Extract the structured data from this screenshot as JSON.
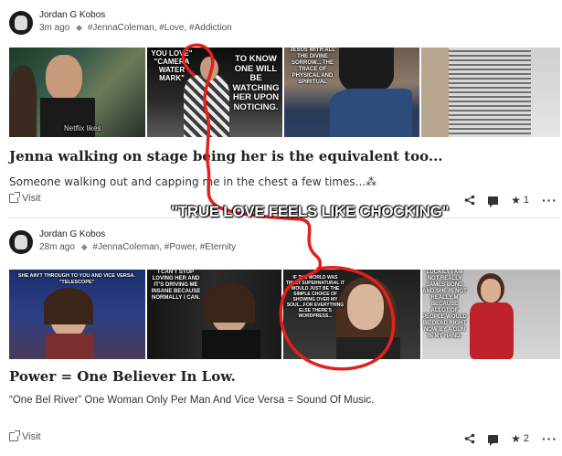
{
  "overlay_caption": "\"TRUE LOVE FEELS LIKE CHOCKING\"",
  "accent_color": "#e3201b",
  "posts": [
    {
      "author": "Jordan G Kobos",
      "time": "3m ago",
      "tags": "#JennaColeman, #Love, #Addiction",
      "images": [
        {
          "caption": "Netflix likes"
        },
        {
          "caption": "YOU LOVE\" \"CAMERA WATER MARK\""
        },
        {
          "caption": "TO KNOW ONE WILL BE WATCHING HER UPON NOTICING."
        },
        {
          "caption": "JESUS WITH ALL THE DIVINE SORROW... THE TRACE OF PHYSICAL AND SPIRITUAL"
        },
        {
          "caption": ""
        }
      ],
      "title": "Jenna walking on stage being her is the equivalent too...",
      "excerpt": "Someone walking out and capping me in the chest a few times...⁂",
      "visit_label": "Visit",
      "upvotes": "1"
    },
    {
      "author": "Jordan G Kobos",
      "time": "28m ago",
      "tags": "#JennaColeman, #Power, #Eternity",
      "images": [
        {
          "caption": "SHE AIN'T THROUGH TO YOU AND VICE VERSA. \"TELESCOPE\""
        },
        {
          "caption": "I CAN'T STOP LOVING HER AND IT'S DRIVING ME INSANE BECAUSE NORMALLY I CAN."
        },
        {
          "caption": ""
        },
        {
          "caption": "IF THE WORLD WAS TRULY SUPERNATURAL IT WOULD JUST BE THE SIMPLE CHOICE OF SHOWING OVER MY SOUL...FOR EVERYTHING ELSE THERE'S WORDPRESS..."
        },
        {
          "caption": "LUCKILY I AM NOT REALLY JAMES BOND AND SHE IS NOT REALLY M BECAUSE ALLOT OF PEOPLE WOULD BE DEAD RIGHT NOW BY A GUN IN MY HAND."
        }
      ],
      "title": "Power = One Believer In Low.",
      "excerpt": "“One Bel River” One Woman Only Per Man And Vice Versa = Sound Of Music.",
      "visit_label": "Visit",
      "upvotes": "2"
    }
  ]
}
